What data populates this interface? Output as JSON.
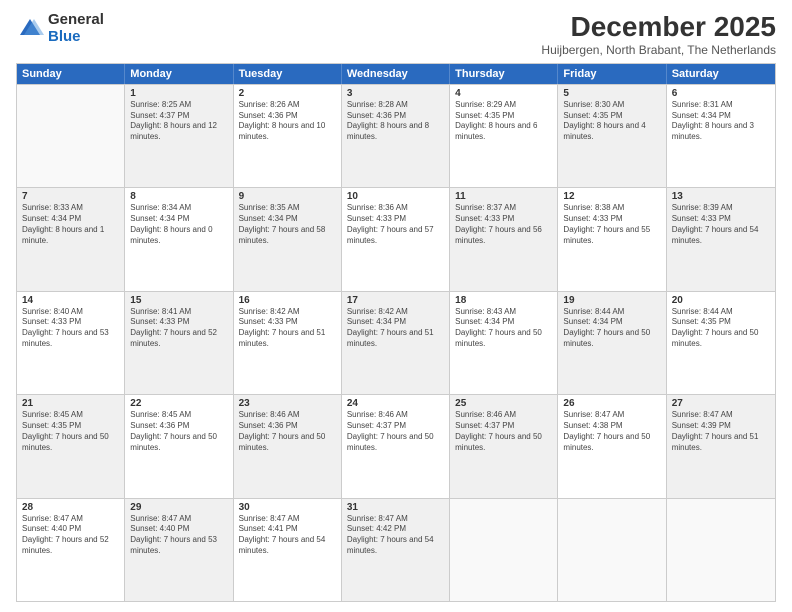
{
  "logo": {
    "general": "General",
    "blue": "Blue"
  },
  "title": "December 2025",
  "subtitle": "Huijbergen, North Brabant, The Netherlands",
  "header_days": [
    "Sunday",
    "Monday",
    "Tuesday",
    "Wednesday",
    "Thursday",
    "Friday",
    "Saturday"
  ],
  "rows": [
    [
      {
        "day": "",
        "sunrise": "",
        "sunset": "",
        "daylight": "",
        "shaded": false,
        "empty": true
      },
      {
        "day": "1",
        "sunrise": "Sunrise: 8:25 AM",
        "sunset": "Sunset: 4:37 PM",
        "daylight": "Daylight: 8 hours and 12 minutes.",
        "shaded": true
      },
      {
        "day": "2",
        "sunrise": "Sunrise: 8:26 AM",
        "sunset": "Sunset: 4:36 PM",
        "daylight": "Daylight: 8 hours and 10 minutes.",
        "shaded": false
      },
      {
        "day": "3",
        "sunrise": "Sunrise: 8:28 AM",
        "sunset": "Sunset: 4:36 PM",
        "daylight": "Daylight: 8 hours and 8 minutes.",
        "shaded": true
      },
      {
        "day": "4",
        "sunrise": "Sunrise: 8:29 AM",
        "sunset": "Sunset: 4:35 PM",
        "daylight": "Daylight: 8 hours and 6 minutes.",
        "shaded": false
      },
      {
        "day": "5",
        "sunrise": "Sunrise: 8:30 AM",
        "sunset": "Sunset: 4:35 PM",
        "daylight": "Daylight: 8 hours and 4 minutes.",
        "shaded": true
      },
      {
        "day": "6",
        "sunrise": "Sunrise: 8:31 AM",
        "sunset": "Sunset: 4:34 PM",
        "daylight": "Daylight: 8 hours and 3 minutes.",
        "shaded": false
      }
    ],
    [
      {
        "day": "7",
        "sunrise": "Sunrise: 8:33 AM",
        "sunset": "Sunset: 4:34 PM",
        "daylight": "Daylight: 8 hours and 1 minute.",
        "shaded": true
      },
      {
        "day": "8",
        "sunrise": "Sunrise: 8:34 AM",
        "sunset": "Sunset: 4:34 PM",
        "daylight": "Daylight: 8 hours and 0 minutes.",
        "shaded": false
      },
      {
        "day": "9",
        "sunrise": "Sunrise: 8:35 AM",
        "sunset": "Sunset: 4:34 PM",
        "daylight": "Daylight: 7 hours and 58 minutes.",
        "shaded": true
      },
      {
        "day": "10",
        "sunrise": "Sunrise: 8:36 AM",
        "sunset": "Sunset: 4:33 PM",
        "daylight": "Daylight: 7 hours and 57 minutes.",
        "shaded": false
      },
      {
        "day": "11",
        "sunrise": "Sunrise: 8:37 AM",
        "sunset": "Sunset: 4:33 PM",
        "daylight": "Daylight: 7 hours and 56 minutes.",
        "shaded": true
      },
      {
        "day": "12",
        "sunrise": "Sunrise: 8:38 AM",
        "sunset": "Sunset: 4:33 PM",
        "daylight": "Daylight: 7 hours and 55 minutes.",
        "shaded": false
      },
      {
        "day": "13",
        "sunrise": "Sunrise: 8:39 AM",
        "sunset": "Sunset: 4:33 PM",
        "daylight": "Daylight: 7 hours and 54 minutes.",
        "shaded": true
      }
    ],
    [
      {
        "day": "14",
        "sunrise": "Sunrise: 8:40 AM",
        "sunset": "Sunset: 4:33 PM",
        "daylight": "Daylight: 7 hours and 53 minutes.",
        "shaded": false
      },
      {
        "day": "15",
        "sunrise": "Sunrise: 8:41 AM",
        "sunset": "Sunset: 4:33 PM",
        "daylight": "Daylight: 7 hours and 52 minutes.",
        "shaded": true
      },
      {
        "day": "16",
        "sunrise": "Sunrise: 8:42 AM",
        "sunset": "Sunset: 4:33 PM",
        "daylight": "Daylight: 7 hours and 51 minutes.",
        "shaded": false
      },
      {
        "day": "17",
        "sunrise": "Sunrise: 8:42 AM",
        "sunset": "Sunset: 4:34 PM",
        "daylight": "Daylight: 7 hours and 51 minutes.",
        "shaded": true
      },
      {
        "day": "18",
        "sunrise": "Sunrise: 8:43 AM",
        "sunset": "Sunset: 4:34 PM",
        "daylight": "Daylight: 7 hours and 50 minutes.",
        "shaded": false
      },
      {
        "day": "19",
        "sunrise": "Sunrise: 8:44 AM",
        "sunset": "Sunset: 4:34 PM",
        "daylight": "Daylight: 7 hours and 50 minutes.",
        "shaded": true
      },
      {
        "day": "20",
        "sunrise": "Sunrise: 8:44 AM",
        "sunset": "Sunset: 4:35 PM",
        "daylight": "Daylight: 7 hours and 50 minutes.",
        "shaded": false
      }
    ],
    [
      {
        "day": "21",
        "sunrise": "Sunrise: 8:45 AM",
        "sunset": "Sunset: 4:35 PM",
        "daylight": "Daylight: 7 hours and 50 minutes.",
        "shaded": true
      },
      {
        "day": "22",
        "sunrise": "Sunrise: 8:45 AM",
        "sunset": "Sunset: 4:36 PM",
        "daylight": "Daylight: 7 hours and 50 minutes.",
        "shaded": false
      },
      {
        "day": "23",
        "sunrise": "Sunrise: 8:46 AM",
        "sunset": "Sunset: 4:36 PM",
        "daylight": "Daylight: 7 hours and 50 minutes.",
        "shaded": true
      },
      {
        "day": "24",
        "sunrise": "Sunrise: 8:46 AM",
        "sunset": "Sunset: 4:37 PM",
        "daylight": "Daylight: 7 hours and 50 minutes.",
        "shaded": false
      },
      {
        "day": "25",
        "sunrise": "Sunrise: 8:46 AM",
        "sunset": "Sunset: 4:37 PM",
        "daylight": "Daylight: 7 hours and 50 minutes.",
        "shaded": true
      },
      {
        "day": "26",
        "sunrise": "Sunrise: 8:47 AM",
        "sunset": "Sunset: 4:38 PM",
        "daylight": "Daylight: 7 hours and 50 minutes.",
        "shaded": false
      },
      {
        "day": "27",
        "sunrise": "Sunrise: 8:47 AM",
        "sunset": "Sunset: 4:39 PM",
        "daylight": "Daylight: 7 hours and 51 minutes.",
        "shaded": true
      }
    ],
    [
      {
        "day": "28",
        "sunrise": "Sunrise: 8:47 AM",
        "sunset": "Sunset: 4:40 PM",
        "daylight": "Daylight: 7 hours and 52 minutes.",
        "shaded": false
      },
      {
        "day": "29",
        "sunrise": "Sunrise: 8:47 AM",
        "sunset": "Sunset: 4:40 PM",
        "daylight": "Daylight: 7 hours and 53 minutes.",
        "shaded": true
      },
      {
        "day": "30",
        "sunrise": "Sunrise: 8:47 AM",
        "sunset": "Sunset: 4:41 PM",
        "daylight": "Daylight: 7 hours and 54 minutes.",
        "shaded": false
      },
      {
        "day": "31",
        "sunrise": "Sunrise: 8:47 AM",
        "sunset": "Sunset: 4:42 PM",
        "daylight": "Daylight: 7 hours and 54 minutes.",
        "shaded": true
      },
      {
        "day": "",
        "sunrise": "",
        "sunset": "",
        "daylight": "",
        "shaded": false,
        "empty": true
      },
      {
        "day": "",
        "sunrise": "",
        "sunset": "",
        "daylight": "",
        "shaded": false,
        "empty": true
      },
      {
        "day": "",
        "sunrise": "",
        "sunset": "",
        "daylight": "",
        "shaded": false,
        "empty": true
      }
    ]
  ]
}
